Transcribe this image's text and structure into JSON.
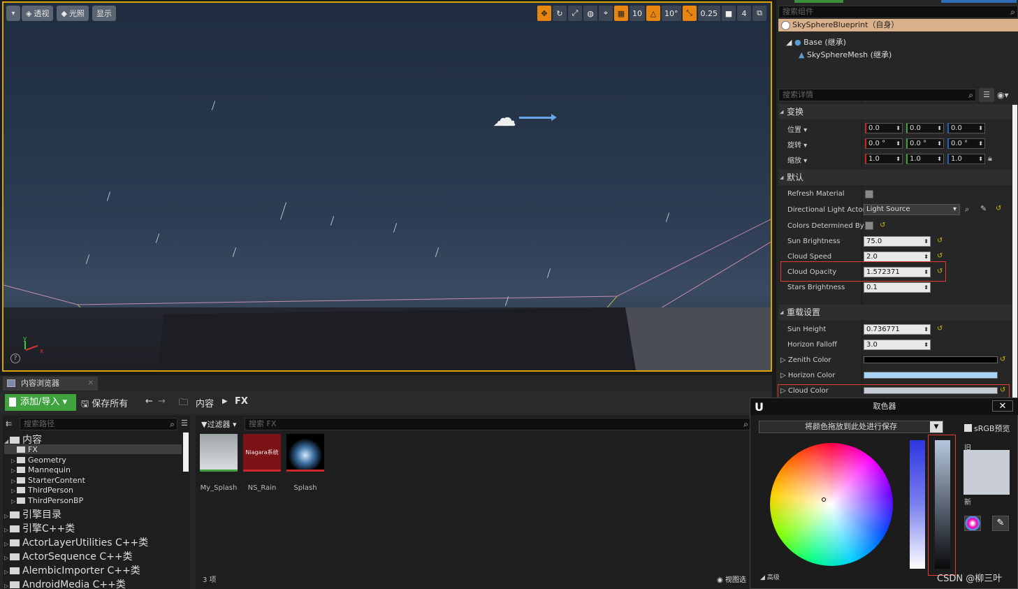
{
  "viewport": {
    "buttons": [
      "透视",
      "光照",
      "显示"
    ],
    "right_values": {
      "grid": "10",
      "rot": "10°",
      "scale": "0.25",
      "cam": "4"
    },
    "axis_x": "x",
    "axis_y": "y",
    "help": "?"
  },
  "components": {
    "search_placeholder": "搜索组件",
    "root": "SkySphereBlueprint（自身）",
    "base": "Base (继承)",
    "mesh": "SkySphereMesh (继承)"
  },
  "details": {
    "search_placeholder": "搜索详情",
    "sections": {
      "transform": "变换",
      "default": "默认",
      "override": "重载设置"
    },
    "transform": {
      "location": {
        "label": "位置",
        "x": "0.0",
        "y": "0.0",
        "z": "0.0"
      },
      "rotation": {
        "label": "旋转",
        "x": "0.0 °",
        "y": "0.0 °",
        "z": "0.0 °"
      },
      "scale": {
        "label": "缩放",
        "x": "1.0",
        "y": "1.0",
        "z": "1.0"
      }
    },
    "props": {
      "refresh_material": "Refresh Material",
      "directional_light_actor": "Directional Light Actor",
      "directional_light_value": "Light Source",
      "colors_determined": "Colors Determined By S",
      "sun_brightness": "Sun Brightness",
      "sun_brightness_value": "75.0",
      "cloud_speed": "Cloud Speed",
      "cloud_speed_value": "2.0",
      "cloud_opacity": "Cloud Opacity",
      "cloud_opacity_value": "1.572371",
      "stars_brightness": "Stars Brightness",
      "stars_brightness_value": "0.1",
      "sun_height": "Sun Height",
      "sun_height_value": "0.736771",
      "horizon_falloff": "Horizon Falloff",
      "horizon_falloff_value": "3.0",
      "zenith_color": "Zenith Color",
      "horizon_color": "Horizon Color",
      "cloud_color": "Cloud Color"
    },
    "colors": {
      "zenith": "#000000",
      "horizon": "#a9d6f5",
      "cloud": "#c9ced6"
    }
  },
  "content_browser": {
    "tab": "内容浏览器",
    "add_import": "添加/导入",
    "save_all": "保存所有",
    "crumb_root": "内容",
    "crumb_fx": "FX",
    "path_search_placeholder": "搜索路径",
    "filter": "过滤器",
    "asset_search_placeholder": "搜索 FX",
    "tree": {
      "content": "内容",
      "fx": "FX",
      "geometry": "Geometry",
      "mannequin": "Mannequin",
      "starter": "StarterContent",
      "thirdperson": "ThirdPerson",
      "thirdpersonbp": "ThirdPersonBP",
      "engine_content": "引擎目录",
      "engine_cpp": "引擎C++类",
      "actor_layer": "ActorLayerUtilities C++类",
      "actor_seq": "ActorSequence C++类",
      "alembic": "AlembicImporter C++类",
      "android": "AndroidMedia C++类"
    },
    "assets": [
      {
        "name": "My_Splash",
        "thumb_text": ""
      },
      {
        "name": "NS_Rain",
        "thumb_text": "Niagara系统"
      },
      {
        "name": "Splash",
        "thumb_text": ""
      }
    ],
    "count": "3 项",
    "view_options": "视图选"
  },
  "color_picker": {
    "title": "取色器",
    "close": "✕",
    "save_drop": "将颜色拖放到此处进行保存",
    "srgb": "sRGB预览",
    "old": "旧",
    "new": "新",
    "advanced": "高级"
  },
  "watermark": "CSDN @柳三叶"
}
